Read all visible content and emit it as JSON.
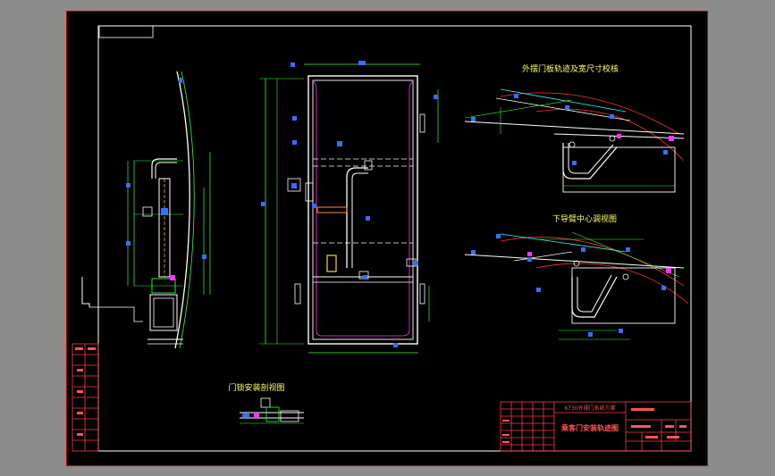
{
  "labels": {
    "outer_panel_view": "外摆门板轨迹及宽尺寸校核",
    "lower_arm_view": "下导臂中心调视图",
    "door_lock_view": "门锁安装剖视图"
  },
  "title_block": {
    "project_line": "6730外摆门系统方案",
    "drawing_title": "乘客门安装轨迹图"
  },
  "colors": {
    "background_outer": "#8c8c8c",
    "sheet": "#000000",
    "border": "#ffffff",
    "title_block_lines": "#ff3b3b",
    "outline": "#ffffff",
    "dimension": "#00ff66",
    "centerline": "#ffd23f",
    "construction": "#ff3333",
    "hinge_path": "#ff5a3c",
    "accent_blue": "#3c6cff",
    "accent_magenta": "#ff33ff",
    "accent_cyan": "#33ffff"
  }
}
